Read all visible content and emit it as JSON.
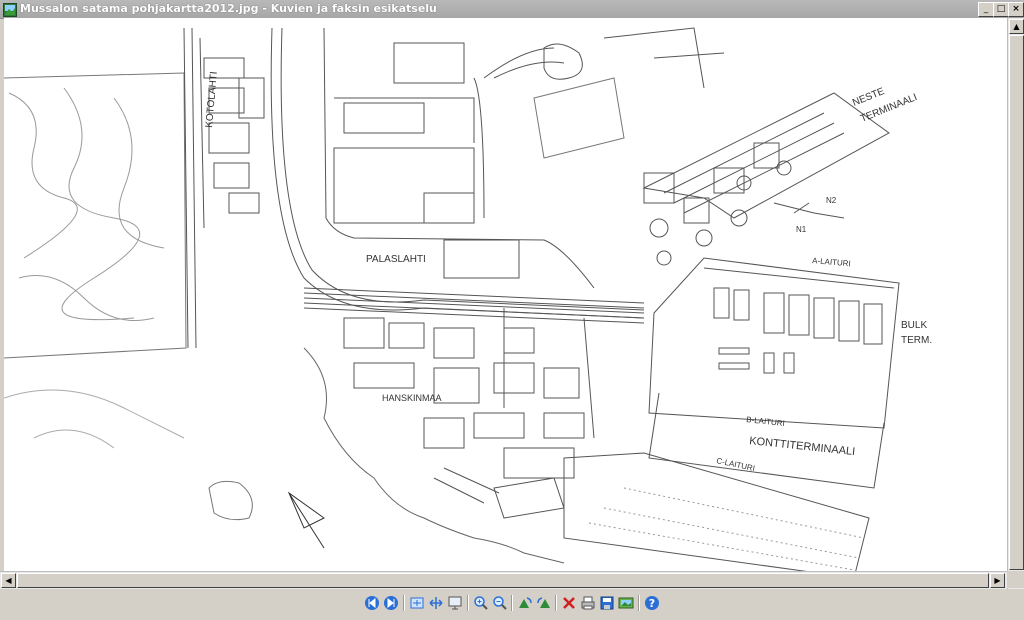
{
  "window": {
    "title": "Mussalon satama pohjakartta2012.jpg - Kuvien ja faksin esikatselu",
    "buttons": {
      "minimize": "_",
      "maximize": "□",
      "close": "×"
    }
  },
  "map": {
    "labels": {
      "kotolahti": "KOTOLAHTI",
      "palaslahti": "PALASLAHTI",
      "hanskinmaa": "HANSKINMAA",
      "neste_terminaali_1": "NESTE",
      "neste_terminaali_2": "TERMINAALI",
      "n1": "N1",
      "n2": "N2",
      "a_laituri": "A-LAITURI",
      "bulk_1": "BULK",
      "bulk_2": "TERM.",
      "b_laituri": "B-LAITURI",
      "konttiterminaali": "KONTTITERMINAALI",
      "c_laituri": "C-LAITURI"
    }
  },
  "toolbar": {
    "buttons": [
      {
        "name": "previous-image-button",
        "icon": "previous-icon"
      },
      {
        "name": "next-image-button",
        "icon": "next-icon"
      },
      {
        "name": "best-fit-button",
        "icon": "best-fit-icon"
      },
      {
        "name": "actual-size-button",
        "icon": "actual-size-icon"
      },
      {
        "name": "slideshow-button",
        "icon": "slideshow-icon"
      },
      {
        "name": "zoom-in-button",
        "icon": "zoom-in-icon"
      },
      {
        "name": "zoom-out-button",
        "icon": "zoom-out-icon"
      },
      {
        "name": "rotate-clockwise-button",
        "icon": "rotate-clockwise-icon"
      },
      {
        "name": "rotate-counterclockwise-button",
        "icon": "rotate-counterclockwise-icon"
      },
      {
        "name": "delete-button",
        "icon": "delete-icon"
      },
      {
        "name": "print-button",
        "icon": "print-icon"
      },
      {
        "name": "save-button",
        "icon": "save-icon"
      },
      {
        "name": "open-for-editing-button",
        "icon": "edit-icon"
      },
      {
        "name": "help-button",
        "icon": "help-icon"
      }
    ]
  },
  "colors": {
    "accent_blue": "#2a6fd6",
    "delete_red": "#d02020",
    "rotate_green": "#2e8b3a"
  }
}
